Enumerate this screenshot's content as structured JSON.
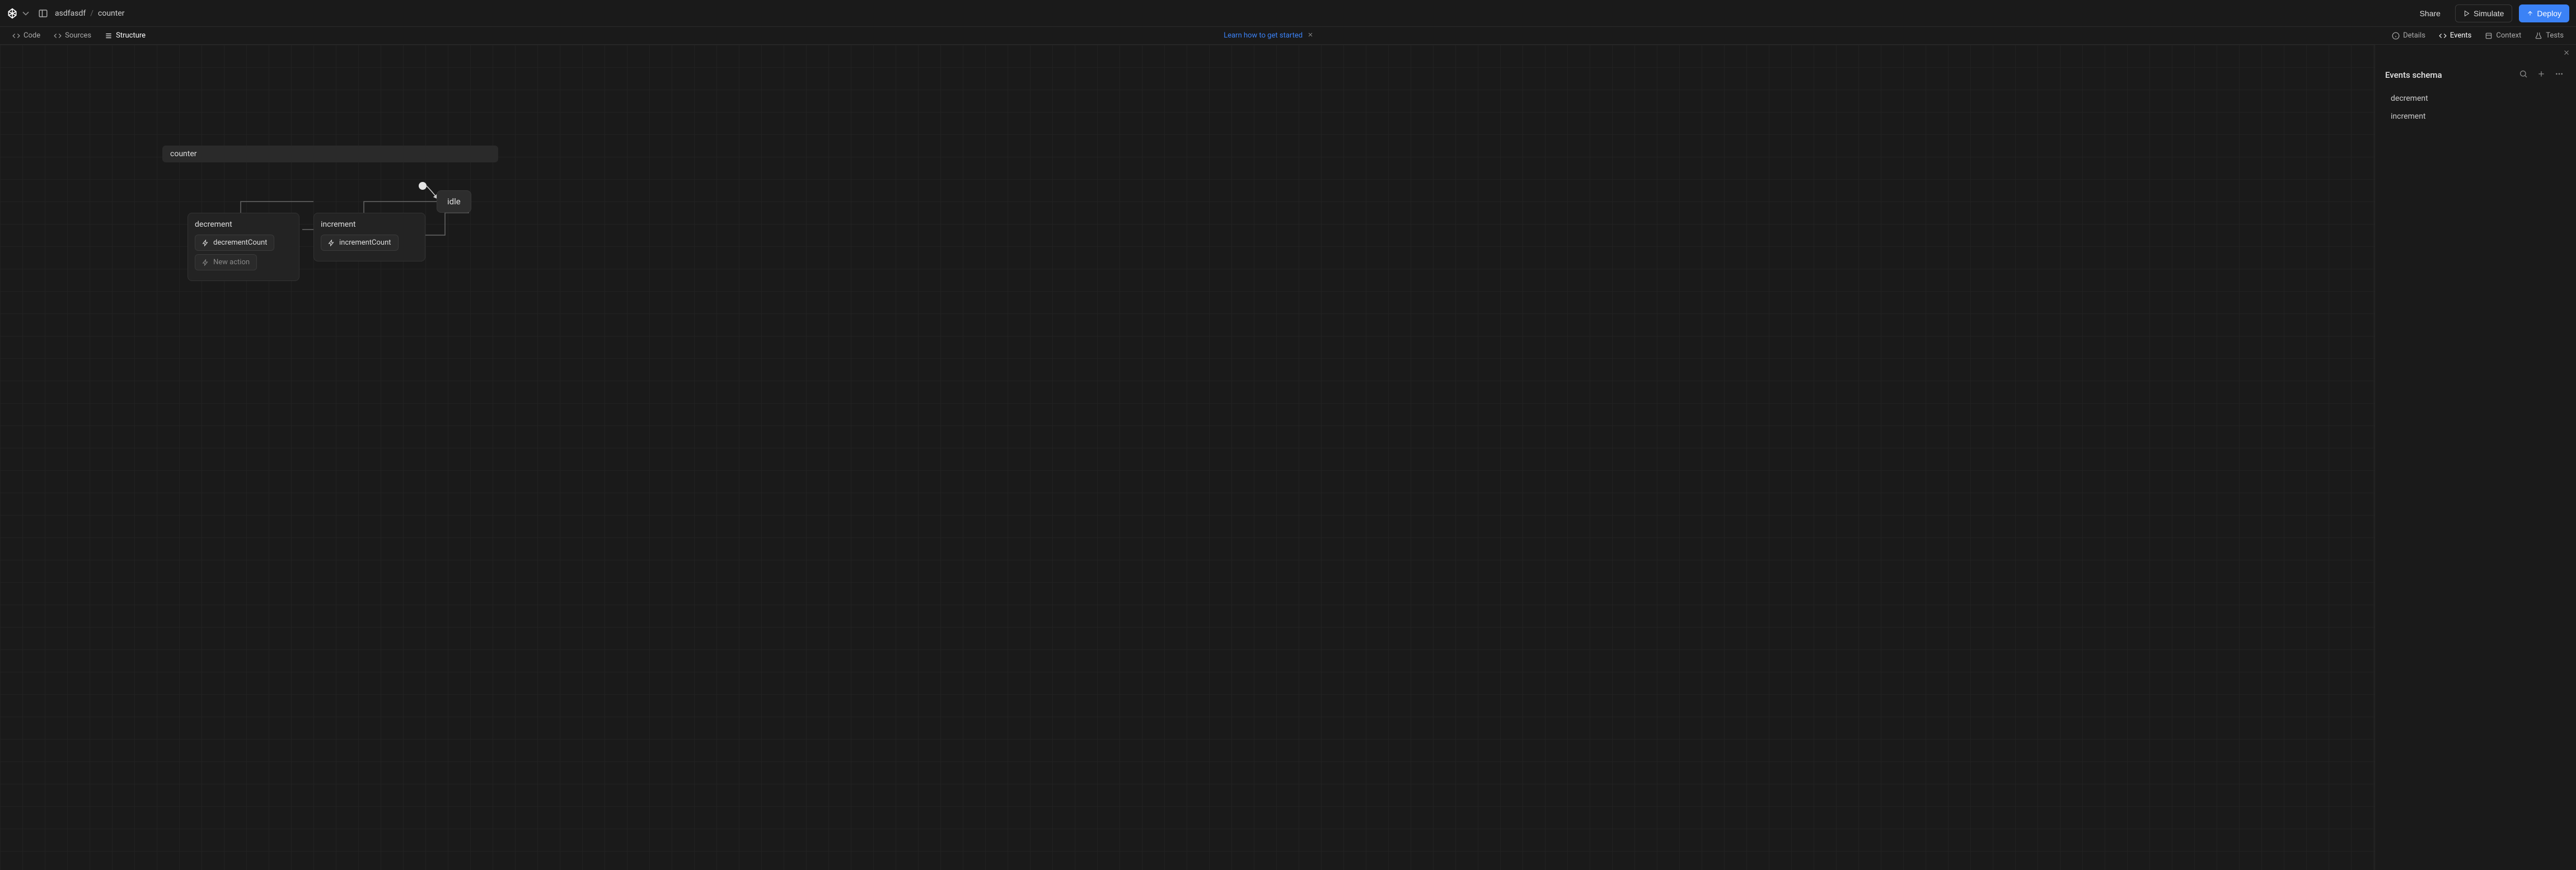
{
  "breadcrumb": {
    "project": "asdfasdf",
    "machine": "counter"
  },
  "topbar": {
    "share": "Share",
    "simulate": "Simulate",
    "deploy": "Deploy"
  },
  "leftTabs": {
    "code": "Code",
    "sources": "Sources",
    "structure": "Structure"
  },
  "banner": {
    "text": "Learn how to get started"
  },
  "rightTabs": {
    "details": "Details",
    "events": "Events",
    "context": "Context",
    "tests": "Tests"
  },
  "canvas": {
    "machineName": "counter",
    "stateIdle": "idle",
    "decrement": {
      "title": "decrement",
      "action": "decrementCount",
      "newAction": "New action"
    },
    "increment": {
      "title": "increment",
      "action": "incrementCount"
    }
  },
  "sidepanel": {
    "title": "Events schema",
    "items": [
      "decrement",
      "increment"
    ]
  }
}
